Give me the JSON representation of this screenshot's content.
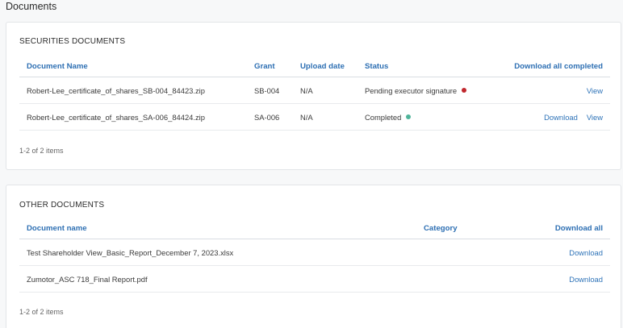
{
  "page": {
    "title": "Documents"
  },
  "securities": {
    "title": "SECURITIES DOCUMENTS",
    "columns": {
      "document_name": "Document Name",
      "grant": "Grant",
      "upload_date": "Upload date",
      "status": "Status",
      "download_all": "Download all completed"
    },
    "rows": [
      {
        "document_name": "Robert-Lee_certificate_of_shares_SB-004_84423.zip",
        "grant": "SB-004",
        "upload_date": "N/A",
        "status": "Pending executor signature",
        "status_color": "#c0272d",
        "actions": [
          "View"
        ]
      },
      {
        "document_name": "Robert-Lee_certificate_of_shares_SA-006_84424.zip",
        "grant": "SA-006",
        "upload_date": "N/A",
        "status": "Completed",
        "status_color": "#4fb49a",
        "actions": [
          "Download",
          "View"
        ]
      }
    ],
    "pager": "1-2 of 2 items"
  },
  "other": {
    "title": "OTHER DOCUMENTS",
    "columns": {
      "document_name": "Document name",
      "category": "Category",
      "download_all": "Download all"
    },
    "rows": [
      {
        "document_name": "Test Shareholder View_Basic_Report_December 7, 2023.xlsx",
        "category": "",
        "action": "Download"
      },
      {
        "document_name": "Zumotor_ASC 718_Final Report.pdf",
        "category": "",
        "action": "Download"
      }
    ],
    "pager": "1-2 of 2 items"
  },
  "colors": {
    "accent": "#2e73b8",
    "pending": "#c0272d",
    "completed": "#4fb49a"
  }
}
